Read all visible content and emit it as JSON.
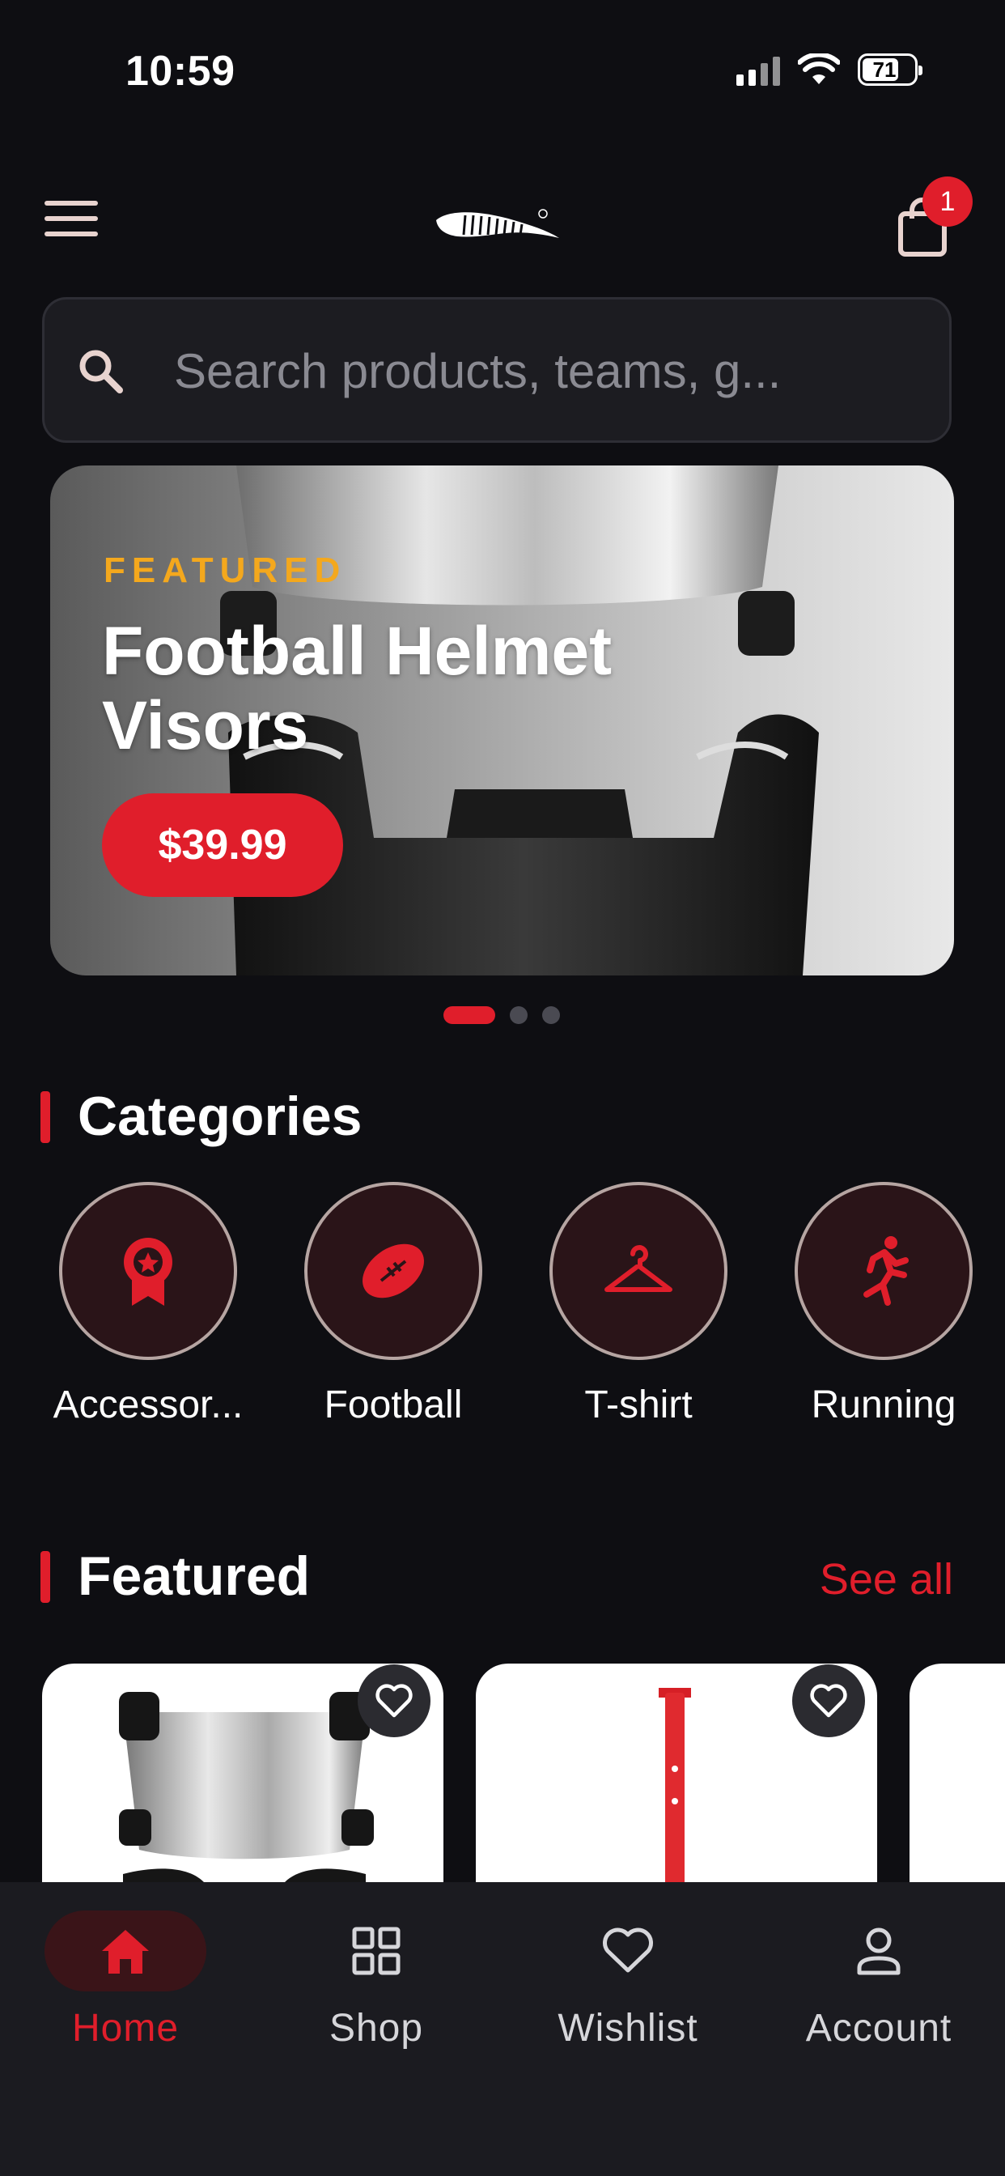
{
  "status_bar": {
    "time": "10:59",
    "battery": "71"
  },
  "header": {
    "cart_count": "1"
  },
  "search": {
    "placeholder": "Search products, teams, g..."
  },
  "hero": {
    "kicker": "FEATURED",
    "title": "Football Helmet Visors",
    "price": "$39.99",
    "slides": 3,
    "active_slide": 1
  },
  "categories": {
    "title": "Categories",
    "items": [
      {
        "label": "Accessor...",
        "icon": "award-icon"
      },
      {
        "label": "Football",
        "icon": "football-icon"
      },
      {
        "label": "T-shirt",
        "icon": "hanger-icon"
      },
      {
        "label": "Running",
        "icon": "running-icon"
      }
    ]
  },
  "featured": {
    "title": "Featured",
    "see_all": "See all"
  },
  "nav": {
    "items": [
      {
        "label": "Home",
        "icon": "home-icon",
        "active": true
      },
      {
        "label": "Shop",
        "icon": "grid-icon"
      },
      {
        "label": "Wishlist",
        "icon": "heart-icon"
      },
      {
        "label": "Account",
        "icon": "person-icon"
      }
    ]
  },
  "colors": {
    "accent": "#e01e2b",
    "kicker": "#f4a81d",
    "background": "#0e0e12"
  }
}
